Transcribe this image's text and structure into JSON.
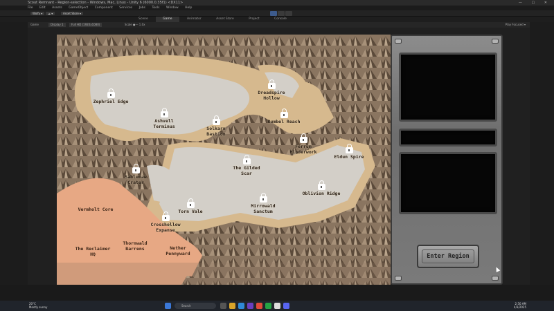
{
  "window": {
    "title": "Scout Remnant - Region-selection - Windows, Mac, Linux - Unity 6 (6000.0.35f1) <DX11>"
  },
  "menu": [
    "File",
    "Edit",
    "Assets",
    "GameObject",
    "Component",
    "Services",
    "Jobs",
    "Tools",
    "Window",
    "Help"
  ],
  "toolbar": {
    "account_label": "Wolfy ▾",
    "cloud_label": "☁ ▾",
    "assetstore_label": "Asset Store ▾"
  },
  "tabs": [
    {
      "label": "Scene"
    },
    {
      "label": "Game",
      "active": true
    },
    {
      "label": "Animator"
    },
    {
      "label": "Asset Store"
    },
    {
      "label": "Project"
    },
    {
      "label": "Console"
    }
  ],
  "gamebar": {
    "mode": "Game",
    "display": "Display 1",
    "resolution": "Full HD (1920x1080)",
    "scale": "Scale ●— 1.0x",
    "right": "Play Focused ▾"
  },
  "map": {
    "regions": [
      {
        "name": "Zephriel Edge",
        "locked": true
      },
      {
        "name": "Ashvell Terminus",
        "locked": true
      },
      {
        "name": "Solkarn Bastion",
        "locked": true
      },
      {
        "name": "Dreadspire Hollow",
        "locked": true
      },
      {
        "name": "Rumbel Reach",
        "locked": true
      },
      {
        "name": "Ferrum Hinderwork",
        "locked": true
      },
      {
        "name": "Eldun Spire",
        "locked": true
      },
      {
        "name": "The Gilded Scar",
        "locked": true
      },
      {
        "name": "Sablemaw Crater",
        "locked": true
      },
      {
        "name": "Oblivion Ridge",
        "locked": true
      },
      {
        "name": "Mirrowald Sanctum",
        "locked": true
      },
      {
        "name": "Torn Vale",
        "locked": true
      },
      {
        "name": "Crosshollow Expanse",
        "locked": true
      }
    ],
    "unlocked": [
      {
        "name": "Vermholt Core"
      },
      {
        "name": "The Reclaimer HQ"
      },
      {
        "name": "Thornwald Barrens"
      },
      {
        "name": "Nether Pennyward"
      }
    ]
  },
  "panel": {
    "enter_label": "Enter Region"
  },
  "taskbar": {
    "weather_temp": "20°C",
    "weather_desc": "Mostly sunny",
    "search_placeholder": "Search",
    "time": "2:50 AM",
    "date": "4/3/2025"
  },
  "colors": {
    "sand": "#d8c59e",
    "clearing": "#d3cfc8",
    "crimson_zone": "#e7a884",
    "panel_metal": "#8a8a8a"
  }
}
